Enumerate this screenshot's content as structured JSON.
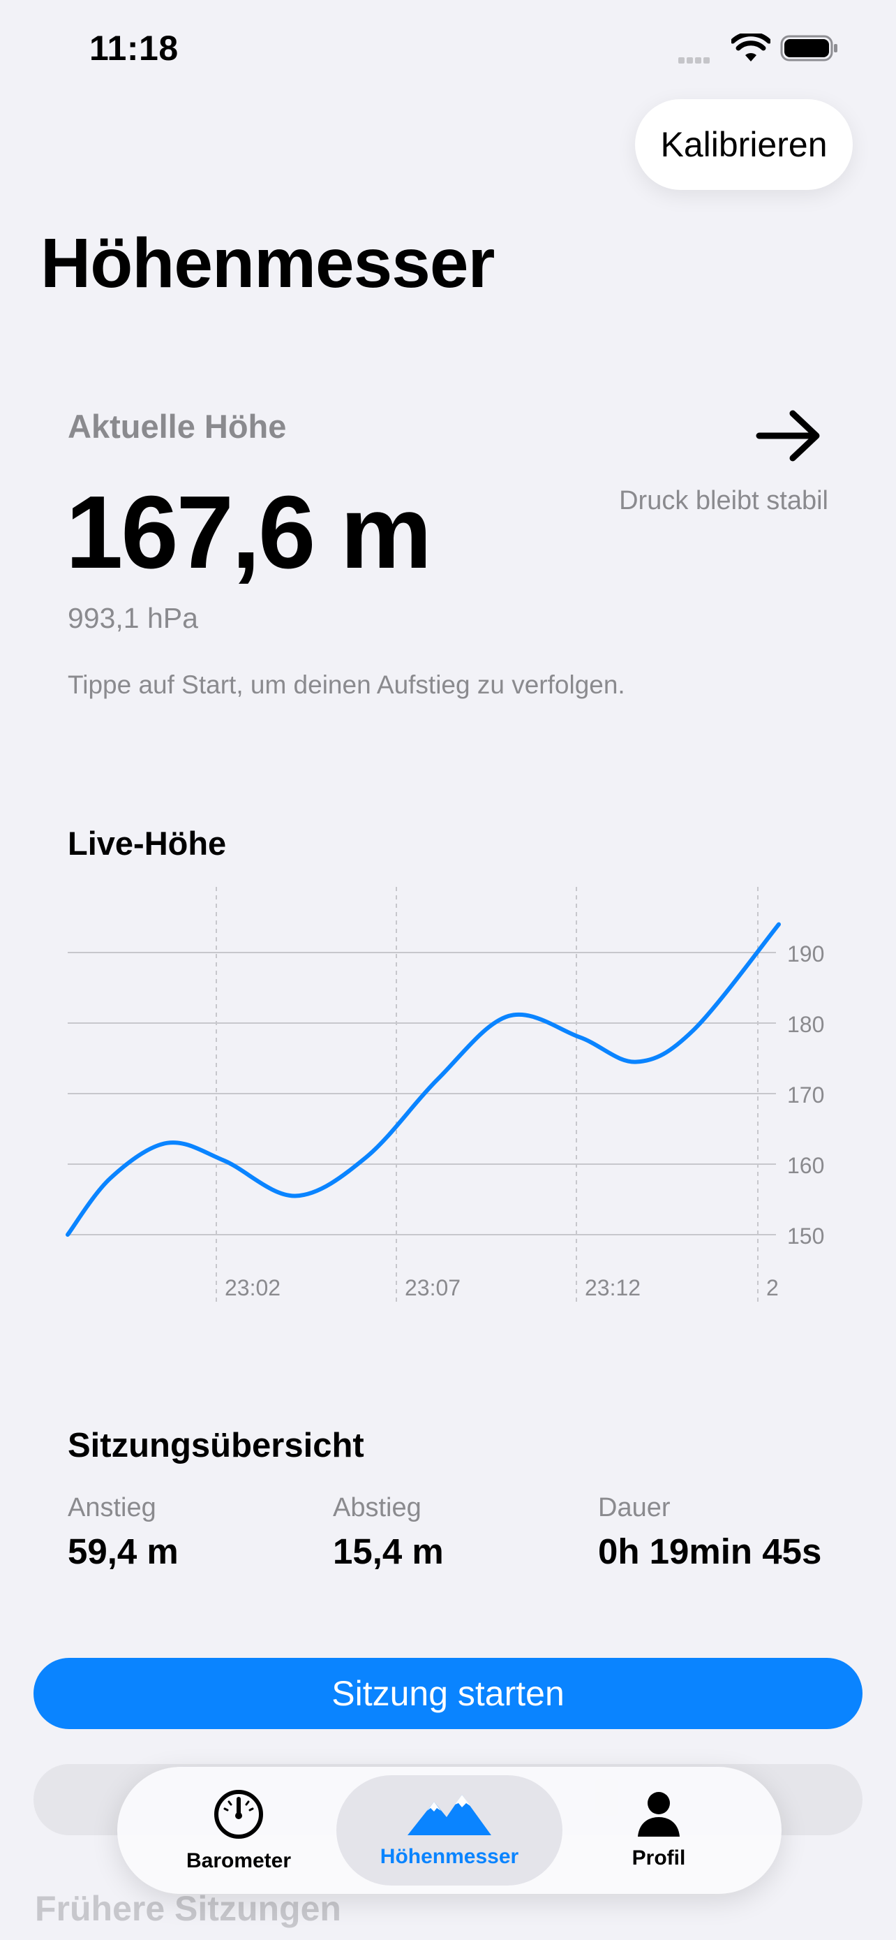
{
  "status_bar": {
    "time": "11:18"
  },
  "header": {
    "calibrate_label": "Kalibrieren",
    "title": "Höhenmesser"
  },
  "current": {
    "label": "Aktuelle Höhe",
    "value": "167,6 m",
    "trend": "Druck bleibt stabil",
    "pressure": "993,1 hPa",
    "hint": "Tippe auf Start, um deinen Aufstieg zu verfolgen."
  },
  "live": {
    "title": "Live-Höhe"
  },
  "chart_data": {
    "type": "line",
    "title": "Live-Höhe",
    "xlabel": "",
    "ylabel": "",
    "x_ticks": [
      "23:02",
      "23:07",
      "23:12",
      "2"
    ],
    "y_ticks": [
      150,
      160,
      170,
      180,
      190
    ],
    "ylim": [
      150,
      194
    ],
    "grid": true,
    "series": [
      {
        "color": "#0a84ff",
        "points": [
          [
            0,
            150
          ],
          [
            0.06,
            158
          ],
          [
            0.14,
            163
          ],
          [
            0.22,
            160.5
          ],
          [
            0.32,
            155.5
          ],
          [
            0.42,
            161
          ],
          [
            0.52,
            172
          ],
          [
            0.62,
            181
          ],
          [
            0.72,
            178
          ],
          [
            0.8,
            174.5
          ],
          [
            0.88,
            179
          ],
          [
            1.0,
            194
          ]
        ]
      }
    ]
  },
  "summary": {
    "title": "Sitzungsübersicht",
    "stats": [
      {
        "label": "Anstieg",
        "value": "59,4 m"
      },
      {
        "label": "Abstieg",
        "value": "15,4 m"
      },
      {
        "label": "Dauer",
        "value": "0h 19min 45s"
      }
    ]
  },
  "actions": {
    "start_label": "Sitzung starten"
  },
  "earlier": {
    "title": "Frühere Sitzungen"
  },
  "tabbar": {
    "items": [
      {
        "label": "Barometer",
        "icon": "gauge-icon"
      },
      {
        "label": "Höhenmesser",
        "icon": "mountain-icon",
        "active": true
      },
      {
        "label": "Profil",
        "icon": "person-icon"
      }
    ],
    "accent": "#0a84ff"
  }
}
